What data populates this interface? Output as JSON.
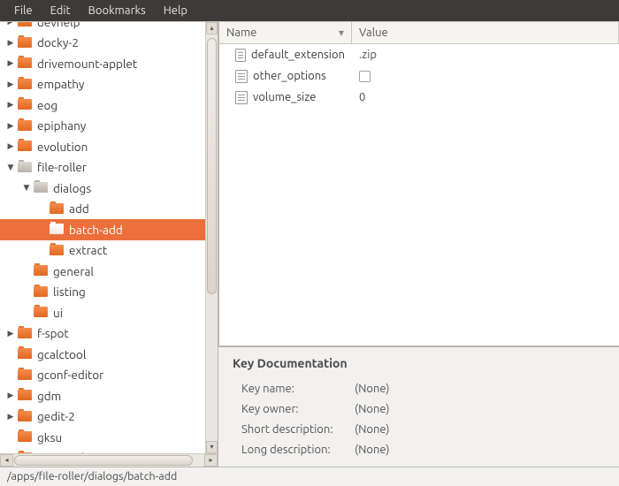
{
  "menubar": [
    "File",
    "Edit",
    "Bookmarks",
    "Help"
  ],
  "tree": [
    {
      "depth": 0,
      "exp": "▶",
      "label": "devhelp",
      "color": "orange",
      "cut": true
    },
    {
      "depth": 0,
      "exp": "▶",
      "label": "docky-2",
      "color": "orange"
    },
    {
      "depth": 0,
      "exp": "▶",
      "label": "drivemount-applet",
      "color": "orange"
    },
    {
      "depth": 0,
      "exp": "▶",
      "label": "empathy",
      "color": "orange"
    },
    {
      "depth": 0,
      "exp": "▶",
      "label": "eog",
      "color": "orange"
    },
    {
      "depth": 0,
      "exp": "▶",
      "label": "epiphany",
      "color": "orange"
    },
    {
      "depth": 0,
      "exp": "▶",
      "label": "evolution",
      "color": "orange"
    },
    {
      "depth": 0,
      "exp": "▼",
      "label": "file-roller",
      "color": "grey"
    },
    {
      "depth": 1,
      "exp": "▼",
      "label": "dialogs",
      "color": "grey"
    },
    {
      "depth": 2,
      "exp": "",
      "label": "add",
      "color": "orange"
    },
    {
      "depth": 2,
      "exp": "",
      "label": "batch-add",
      "color": "orange",
      "selected": true,
      "open": true
    },
    {
      "depth": 2,
      "exp": "",
      "label": "extract",
      "color": "orange"
    },
    {
      "depth": 1,
      "exp": "",
      "label": "general",
      "color": "orange"
    },
    {
      "depth": 1,
      "exp": "",
      "label": "listing",
      "color": "orange"
    },
    {
      "depth": 1,
      "exp": "",
      "label": "ui",
      "color": "orange"
    },
    {
      "depth": 0,
      "exp": "▶",
      "label": "f-spot",
      "color": "orange"
    },
    {
      "depth": 0,
      "exp": "",
      "label": "gcalctool",
      "color": "orange"
    },
    {
      "depth": 0,
      "exp": "",
      "label": "gconf-editor",
      "color": "orange"
    },
    {
      "depth": 0,
      "exp": "▶",
      "label": "gdm",
      "color": "orange"
    },
    {
      "depth": 0,
      "exp": "▶",
      "label": "gedit-2",
      "color": "orange"
    },
    {
      "depth": 0,
      "exp": "",
      "label": "gksu",
      "color": "orange"
    },
    {
      "depth": 0,
      "exp": "",
      "label": "gm-notify",
      "color": "orange",
      "cutbottom": true
    }
  ],
  "table": {
    "headers": {
      "name": "Name",
      "value": "Value"
    },
    "rows": [
      {
        "name": "default_extension",
        "value": ".zip",
        "type": "text"
      },
      {
        "name": "other_options",
        "value": "",
        "type": "bool"
      },
      {
        "name": "volume_size",
        "value": "0",
        "type": "text"
      }
    ]
  },
  "doc": {
    "title": "Key Documentation",
    "labels": {
      "key_name": "Key name:",
      "key_owner": "Key owner:",
      "short_desc": "Short description:",
      "long_desc": "Long description:"
    },
    "values": {
      "key_name": "(None)",
      "key_owner": "(None)",
      "short_desc": "(None)",
      "long_desc": "(None)"
    }
  },
  "status_path": "/apps/file-roller/dialogs/batch-add"
}
